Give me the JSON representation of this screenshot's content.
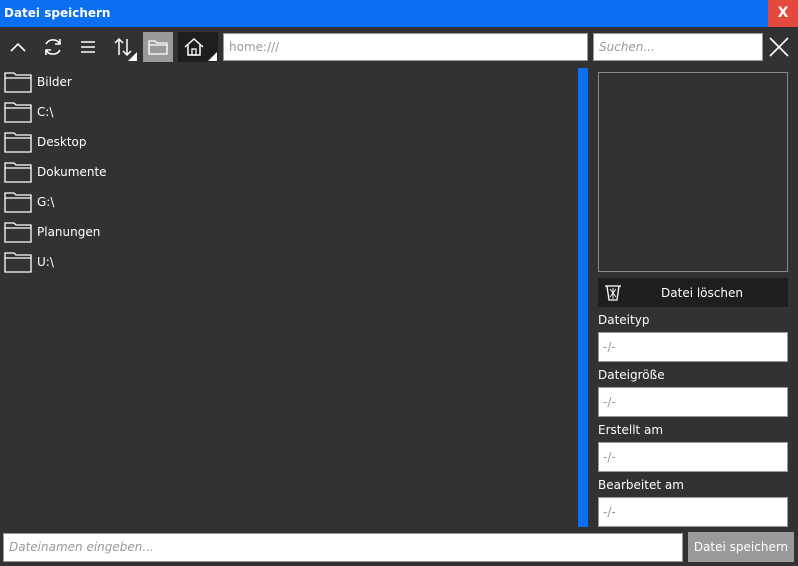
{
  "window": {
    "title": "Datei speichern",
    "close_label": "X"
  },
  "toolbar": {
    "icons": [
      "chevron-up-icon",
      "refresh-icon",
      "list-view-icon",
      "sort-icon",
      "folder-view-icon",
      "home-icon"
    ],
    "path_value": "home:///",
    "search_placeholder": "Suchen..."
  },
  "files": [
    {
      "name": "Bilder"
    },
    {
      "name": "C:\\"
    },
    {
      "name": "Desktop"
    },
    {
      "name": "Dokumente"
    },
    {
      "name": "G:\\"
    },
    {
      "name": "Planungen"
    },
    {
      "name": "U:\\"
    }
  ],
  "details": {
    "delete_label": "Datei löschen",
    "filetype_label": "Dateityp",
    "filetype_value": "-/-",
    "filesize_label": "Dateigröße",
    "filesize_value": "-/-",
    "created_label": "Erstellt am",
    "created_value": "-/-",
    "modified_label": "Bearbeitet am",
    "modified_value": "-/-"
  },
  "footer": {
    "filename_placeholder": "Dateinamen eingeben...",
    "save_label": "Datei speichern"
  },
  "colors": {
    "titlebar": "#0a6ff0",
    "close": "#e34a3d",
    "background": "#323232",
    "scrollbar": "#0a6ff0",
    "disabled_button": "#9a9a9a"
  }
}
